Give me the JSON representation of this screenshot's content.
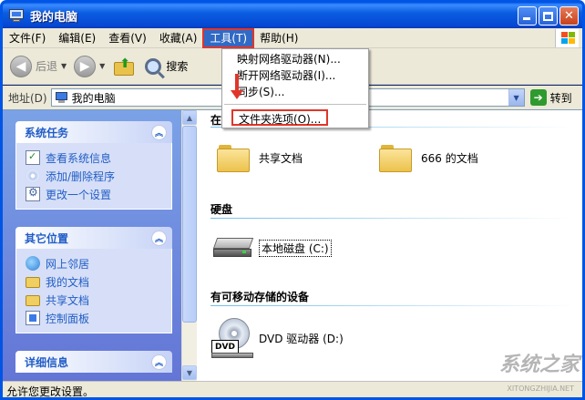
{
  "window": {
    "title": "我的电脑"
  },
  "menubar": {
    "items": [
      {
        "label": "文件(F)"
      },
      {
        "label": "编辑(E)"
      },
      {
        "label": "查看(V)"
      },
      {
        "label": "收藏(A)"
      },
      {
        "label": "工具(T)"
      },
      {
        "label": "帮助(H)"
      }
    ]
  },
  "toolbar": {
    "back_label": "后退",
    "search_label": "搜索"
  },
  "address": {
    "label": "地址(D)",
    "value": "我的电脑",
    "go_label": "转到"
  },
  "tools_menu": {
    "items": [
      {
        "label": "映射网络驱动器(N)..."
      },
      {
        "label": "断开网络驱动器(I)..."
      },
      {
        "label": "同步(S)..."
      },
      {
        "label": "文件夹选项(O)..."
      }
    ]
  },
  "sidebar": {
    "panels": [
      {
        "title": "系统任务",
        "items": [
          {
            "label": "查看系统信息",
            "icon": "system-info-icon"
          },
          {
            "label": "添加/删除程序",
            "icon": "add-remove-icon"
          },
          {
            "label": "更改一个设置",
            "icon": "settings-icon"
          }
        ]
      },
      {
        "title": "其它位置",
        "items": [
          {
            "label": "网上邻居",
            "icon": "network-icon"
          },
          {
            "label": "我的文档",
            "icon": "documents-icon"
          },
          {
            "label": "共享文档",
            "icon": "shared-folder-icon"
          },
          {
            "label": "控制面板",
            "icon": "control-panel-icon"
          }
        ]
      },
      {
        "title": "详细信息",
        "items": []
      }
    ]
  },
  "main": {
    "groups": [
      {
        "title": "在",
        "items": [
          {
            "label": "共享文档"
          },
          {
            "label": "666 的文档"
          }
        ]
      },
      {
        "title": "硬盘",
        "items": [
          {
            "label": "本地磁盘 (C:)"
          }
        ]
      },
      {
        "title": "有可移动存储的设备",
        "items": [
          {
            "label": "DVD 驱动器 (D:)",
            "badge": "DVD"
          }
        ]
      }
    ]
  },
  "statusbar": {
    "text": "允许您更改设置。"
  },
  "watermark": {
    "text": "系统之家",
    "sub": "XITONGZHIJIA.NET"
  }
}
